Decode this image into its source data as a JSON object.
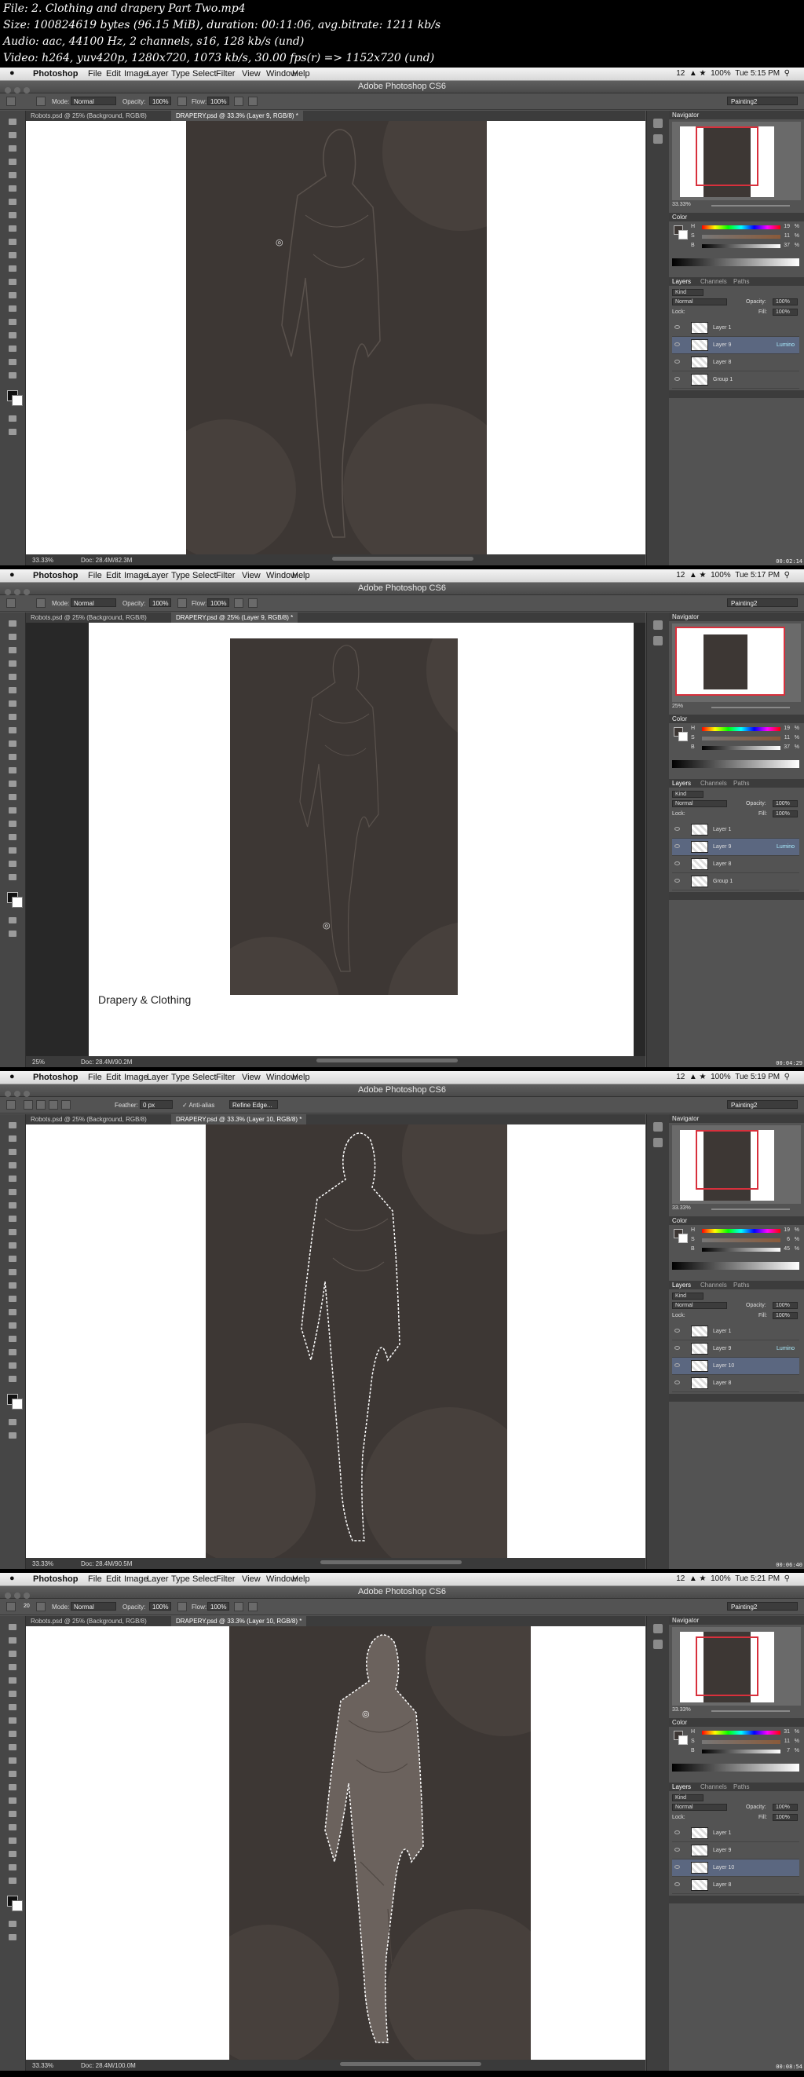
{
  "info": {
    "line1": "File: 2. Clothing and drapery  Part Two.mp4",
    "line2": "Size: 100824619 bytes (96.15 MiB), duration: 00:11:06, avg.bitrate: 1211 kb/s",
    "line3": "Audio: aac, 44100 Hz, 2 channels, s16, 128 kb/s (und)",
    "line4": "Video: h264, yuv420p, 1280x720, 1073 kb/s, 30.00 fps(r) => 1152x720 (und)"
  },
  "menu": {
    "apple": "",
    "app": "Photoshop",
    "items": [
      "File",
      "Edit",
      "Image",
      "Layer",
      "Type",
      "Select",
      "Filter",
      "View",
      "Window",
      "Help"
    ],
    "battery": "100%",
    "status_num": "12"
  },
  "window_title": "Adobe Photoshop CS6",
  "workspace": "Painting2",
  "colors": {
    "accent": "#d8303c",
    "selected_layer": "#5b6780",
    "panel": "#535353",
    "canvas_bg": "#282828"
  },
  "frames": [
    {
      "clock": "Tue 5:15 PM",
      "timestamp": "00:02:14",
      "options": {
        "mode_label": "Mode:",
        "mode": "Normal",
        "opacity_label": "Opacity:",
        "opacity": "100%",
        "flow_label": "Flow:",
        "flow": "100%",
        "brush_size": ""
      },
      "tabs": [
        "Robots.psd @ 25% (Background, RGB/8)",
        "DRAPERY.psd @ 33.3% (Layer 9, RGB/8) *"
      ],
      "zoom": "33.33%",
      "doc": "Doc: 28.4M/82.3M",
      "nav_zoom": "33.33%",
      "color": {
        "h": "19",
        "s": "11",
        "b": "37"
      },
      "blend": "Normal",
      "opacity": "100%",
      "fill": "100%",
      "layers": [
        {
          "name": "Layer 1",
          "fx": "",
          "sel": false
        },
        {
          "name": "Layer 9",
          "fx": "Lumino",
          "sel": true
        },
        {
          "name": "Layer 8",
          "fx": "",
          "sel": false
        },
        {
          "name": "Group 1",
          "fx": "",
          "sel": false
        }
      ]
    },
    {
      "clock": "Tue 5:17 PM",
      "timestamp": "00:04:29",
      "options": {
        "mode_label": "Mode:",
        "mode": "Normal",
        "opacity_label": "Opacity:",
        "opacity": "100%",
        "flow_label": "Flow:",
        "flow": "100%",
        "brush_size": ""
      },
      "tabs": [
        "Robots.psd @ 25% (Background, RGB/8)",
        "DRAPERY.psd @ 25% (Layer 9, RGB/8) *"
      ],
      "zoom": "25%",
      "doc": "Doc: 28.4M/90.2M",
      "nav_zoom": "25%",
      "caption": "Drapery & Clothing",
      "color": {
        "h": "19",
        "s": "11",
        "b": "37"
      },
      "blend": "Normal",
      "opacity": "100%",
      "fill": "100%",
      "layers": [
        {
          "name": "Layer 1",
          "fx": "",
          "sel": false
        },
        {
          "name": "Layer 9",
          "fx": "Lumino",
          "sel": true
        },
        {
          "name": "Layer 8",
          "fx": "",
          "sel": false
        },
        {
          "name": "Group 1",
          "fx": "",
          "sel": false
        }
      ]
    },
    {
      "clock": "Tue 5:19 PM",
      "timestamp": "00:06:40",
      "options": {
        "feather_label": "Feather:",
        "feather": "0 px",
        "antialias": "Anti-alias",
        "refine": "Refine Edge..."
      },
      "tabs": [
        "Robots.psd @ 25% (Background, RGB/8)",
        "DRAPERY.psd @ 33.3% (Layer 10, RGB/8) *"
      ],
      "zoom": "33.33%",
      "doc": "Doc: 28.4M/90.5M",
      "nav_zoom": "33.33%",
      "color": {
        "h": "19",
        "s": "6",
        "b": "45"
      },
      "blend": "Normal",
      "opacity": "100%",
      "fill": "100%",
      "layers": [
        {
          "name": "Layer 1",
          "fx": "",
          "sel": false
        },
        {
          "name": "Layer 9",
          "fx": "Lumino",
          "sel": false
        },
        {
          "name": "Layer 10",
          "fx": "",
          "sel": true
        },
        {
          "name": "Layer 8",
          "fx": "",
          "sel": false
        }
      ]
    },
    {
      "clock": "Tue 5:21 PM",
      "timestamp": "00:08:54",
      "options": {
        "mode_label": "Mode:",
        "mode": "Normal",
        "opacity_label": "Opacity:",
        "opacity": "100%",
        "flow_label": "Flow:",
        "flow": "100%",
        "brush_size": "20"
      },
      "tabs": [
        "Robots.psd @ 25% (Background, RGB/8)",
        "DRAPERY.psd @ 33.3% (Layer 10, RGB/8) *"
      ],
      "zoom": "33.33%",
      "doc": "Doc: 28.4M/100.0M",
      "nav_zoom": "33.33%",
      "color": {
        "h": "31",
        "s": "11",
        "b": "7"
      },
      "blend": "Normal",
      "opacity": "100%",
      "fill": "100%",
      "layers": [
        {
          "name": "Layer 1",
          "fx": "",
          "sel": false
        },
        {
          "name": "Layer 9",
          "fx": "",
          "sel": false
        },
        {
          "name": "Layer 10",
          "fx": "",
          "sel": true
        },
        {
          "name": "Layer 8",
          "fx": "",
          "sel": false
        }
      ]
    }
  ],
  "panels": {
    "navigator": "Navigator",
    "color": "Color",
    "layers_tab": "Layers",
    "channels_tab": "Channels",
    "paths_tab": "Paths",
    "kind": "Kind",
    "lock": "Lock:",
    "opacity_label": "Opacity:",
    "fill_label": "Fill:",
    "h": "H",
    "s": "S",
    "b": "B",
    "pct": "%"
  }
}
